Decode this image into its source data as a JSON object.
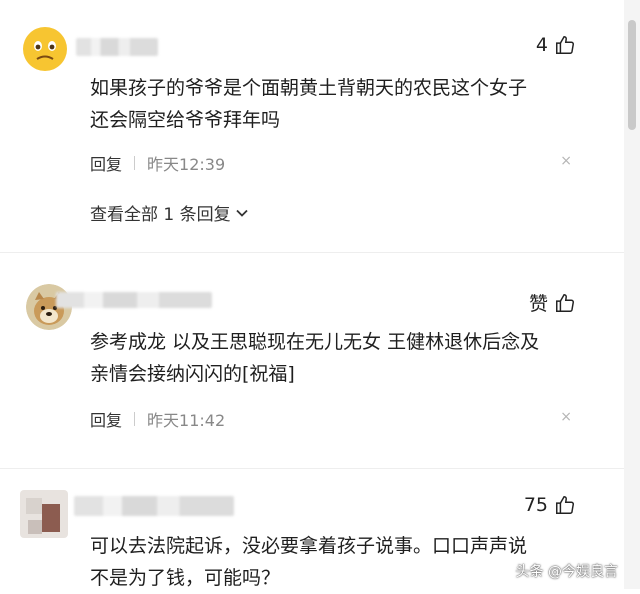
{
  "comments": [
    {
      "likes": "4",
      "text_line1": "如果孩子的爷爷是个面朝黄土背朝天的农民这个女子",
      "text_line2": "还会隔空给爷爷拜年吗",
      "reply_label": "回复",
      "time": "昨天12:39",
      "view_all": "查看全部 1 条回复"
    },
    {
      "likes": "赞",
      "text_line1": "参考成龙 以及王思聪现在无儿无女 王健林退休后念及",
      "text_line2": "亲情会接纳闪闪的[祝福]",
      "reply_label": "回复",
      "time": "昨天11:42"
    },
    {
      "likes": "75",
      "text_line1": "可以去法院起诉，没必要拿着孩子说事。口口声声说",
      "text_line2": "不是为了钱，可能吗？"
    }
  ],
  "watermark": "头条 @今娱良言",
  "close_glyph": "×"
}
